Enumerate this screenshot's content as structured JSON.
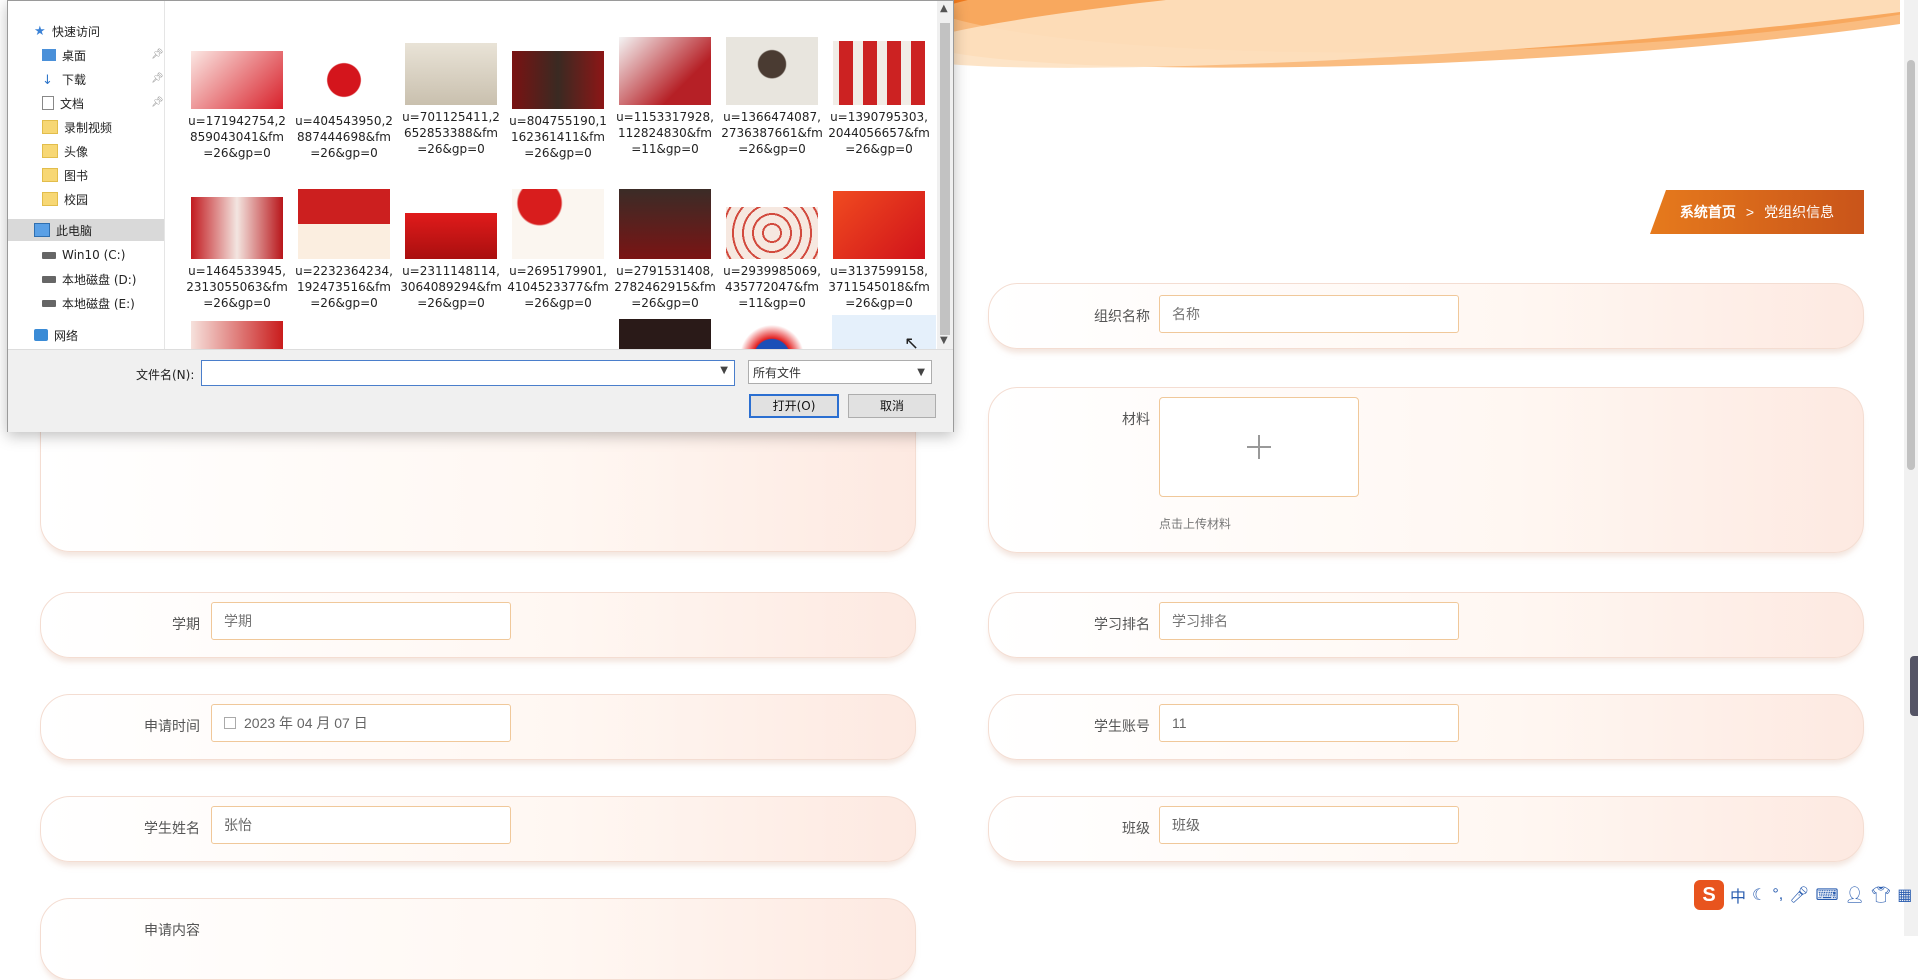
{
  "breadcrumb": {
    "home": "系统首页",
    "sep": ">",
    "current": "党组织信息"
  },
  "form": {
    "org_name": {
      "label": "组织名称",
      "placeholder": "名称"
    },
    "material": {
      "label": "材料",
      "hint": "点击上传材料"
    },
    "term": {
      "label": "学期",
      "placeholder": "学期"
    },
    "study_rank": {
      "label": "学习排名",
      "placeholder": "学习排名"
    },
    "apply_time": {
      "label": "申请时间",
      "value": "2023 年 04 月 07 日"
    },
    "student_account": {
      "label": "学生账号",
      "value": "11"
    },
    "student_name": {
      "label": "学生姓名",
      "value": "张怡"
    },
    "class": {
      "label": "班级",
      "placeholder": "班级"
    },
    "apply_content": {
      "label": "申请内容"
    }
  },
  "dialog": {
    "nav": {
      "quick_access": "快速访问",
      "desktop": "桌面",
      "downloads": "下载",
      "documents": "文档",
      "recordings": "录制视频",
      "avatars": "头像",
      "books": "图书",
      "campus": "校园",
      "this_pc": "此电脑",
      "drive_c": "Win10 (C:)",
      "drive_d": "本地磁盘 (D:)",
      "drive_e": "本地磁盘 (E:)",
      "network": "网络"
    },
    "files": [
      "u=171942754,2859043041&fm=26&gp=0",
      "u=404543950,2887444698&fm=26&gp=0",
      "u=701125411,2652853388&fm=26&gp=0",
      "u=804755190,1162361411&fm=26&gp=0",
      "u=1153317928,112824830&fm=11&gp=0",
      "u=1366474087,2736387661&fm=26&gp=0",
      "u=1390795303,2044056657&fm=26&gp=0",
      "u=1464533945,2313055063&fm=26&gp=0",
      "u=2232364234,192473516&fm=26&gp=0",
      "u=2311148114,3064089294&fm=26&gp=0",
      "u=2695179901,4104523377&fm=26&gp=0",
      "u=2791531408,2782462915&fm=26&gp=0",
      "u=2939985069,435772047&fm=11&gp=0",
      "u=3137599158,3711545018&fm=26&gp=0"
    ],
    "filename_label": "文件名(N):",
    "filetype": "所有文件",
    "open_btn": "打开(O)",
    "cancel_btn": "取消"
  },
  "ime": {
    "logo": "S",
    "mode": "中"
  },
  "icons": {
    "nav": [
      "star-icon",
      "desktop-icon",
      "download-icon",
      "document-icon",
      "folder-icon",
      "computer-icon",
      "drive-icon",
      "network-icon",
      "pin-icon"
    ],
    "form": [
      "calendar-icon",
      "plus-icon"
    ],
    "dialog": [
      "chevron-up-icon",
      "chevron-down-icon"
    ],
    "ime": [
      "sogou-logo-icon",
      "moon-icon",
      "punctuation-icon",
      "microphone-icon",
      "keyboard-icon",
      "user-icon",
      "skin-icon",
      "grid-icon"
    ]
  },
  "colors": {
    "accent": "#e67a1c",
    "input_border": "#f0c89a",
    "dialog_focus": "#2b6fd1"
  }
}
